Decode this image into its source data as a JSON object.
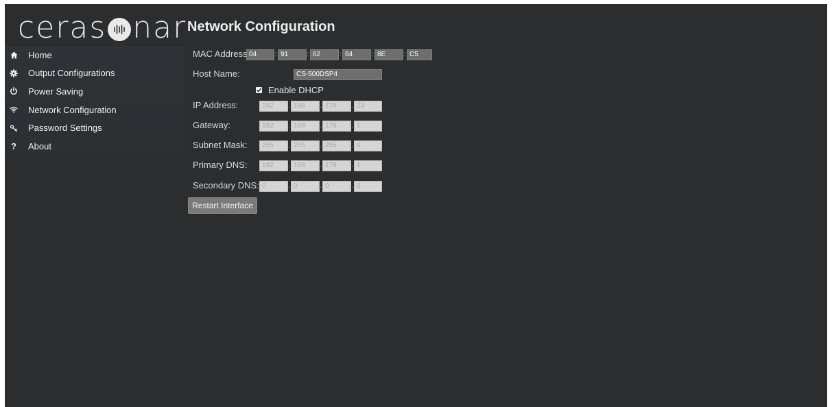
{
  "header": {
    "logo_text_left": "ceras",
    "logo_text_right": "nar",
    "page_title": "Network Configuration"
  },
  "sidebar": {
    "items": [
      {
        "label": "Home",
        "icon": "home-icon"
      },
      {
        "label": "Output Configurations",
        "icon": "gear-icon"
      },
      {
        "label": "Power Saving",
        "icon": "power-icon"
      },
      {
        "label": "Network Configuration",
        "icon": "wifi-icon"
      },
      {
        "label": "Password Settings",
        "icon": "key-icon"
      },
      {
        "label": "About",
        "icon": "question-icon"
      }
    ]
  },
  "form": {
    "mac_label": "MAC Address:",
    "mac": [
      "04",
      "91",
      "62",
      "64",
      "8E",
      "C5"
    ],
    "host_label": "Host Name:",
    "host_name": "CS-500DSP4",
    "dhcp_label": "Enable DHCP",
    "dhcp_checked": true,
    "ip_label": "IP Address:",
    "ip": [
      "192",
      "168",
      "178",
      "23"
    ],
    "gateway_label": "Gateway:",
    "gateway": [
      "192",
      "168",
      "178",
      "1"
    ],
    "subnet_label": "Subnet Mask:",
    "subnet": [
      "255",
      "255",
      "255",
      "0"
    ],
    "dns1_label": "Primary DNS:",
    "dns1": [
      "192",
      "168",
      "178",
      "1"
    ],
    "dns2_label": "Secondary DNS:",
    "dns2": [
      "0",
      "0",
      "0",
      "0"
    ],
    "restart_label": "Restart Interface"
  },
  "colors": {
    "background": "#2b2d2f",
    "sidebar": "#2f3337",
    "mac_field": "#6e6e6e",
    "ip_field": "#d5d5d5"
  }
}
